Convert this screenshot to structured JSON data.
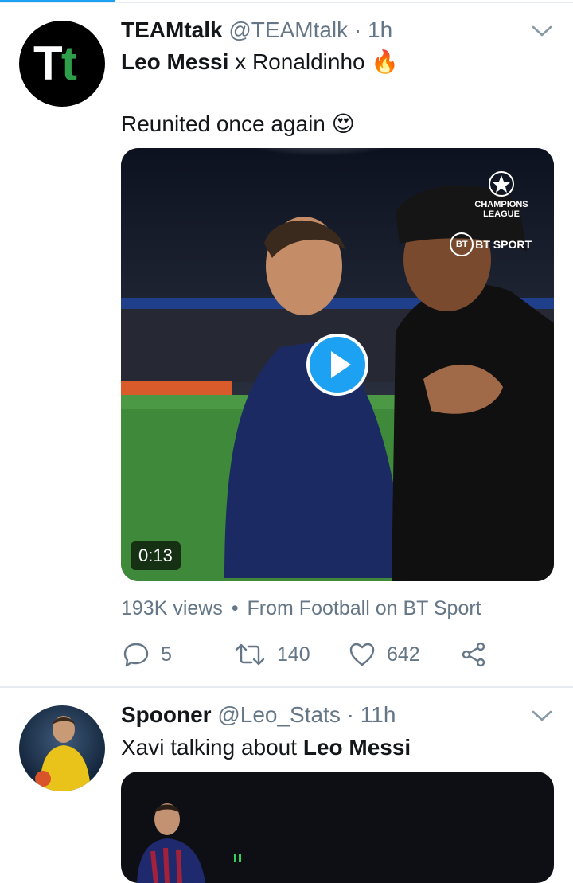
{
  "tweets": [
    {
      "avatar_text": "Tt",
      "name": "TEAMtalk",
      "handle": "@TEAMtalk",
      "separator": "·",
      "time": "1h",
      "text_line1": {
        "bold": "Leo Messi",
        "rest": " x Ronaldinho",
        "emoji": "🔥"
      },
      "text_line2": {
        "text": "Reunited once again",
        "emoji": "😍"
      },
      "media": {
        "duration": "0:13",
        "overlay_competition": "CHAMPIONS LEAGUE",
        "overlay_broadcaster": "BT SPORT"
      },
      "meta": {
        "views": "193K views",
        "dot": "•",
        "source": "From Football on BT Sport"
      },
      "actions": {
        "replies": "5",
        "retweets": "140",
        "likes": "642"
      }
    },
    {
      "name": "Spooner",
      "handle": "@Leo_Stats",
      "separator": "·",
      "time": "11h",
      "text_line1": {
        "rest": "Xavi talking about ",
        "bold": "Leo Messi"
      }
    }
  ],
  "colors": {
    "accent": "#1da1f2",
    "secondary_text": "#657786",
    "divider": "#e6ecf0"
  },
  "icons": [
    "chevron-down-icon",
    "play-icon",
    "reply-icon",
    "retweet-icon",
    "like-icon",
    "share-icon"
  ]
}
